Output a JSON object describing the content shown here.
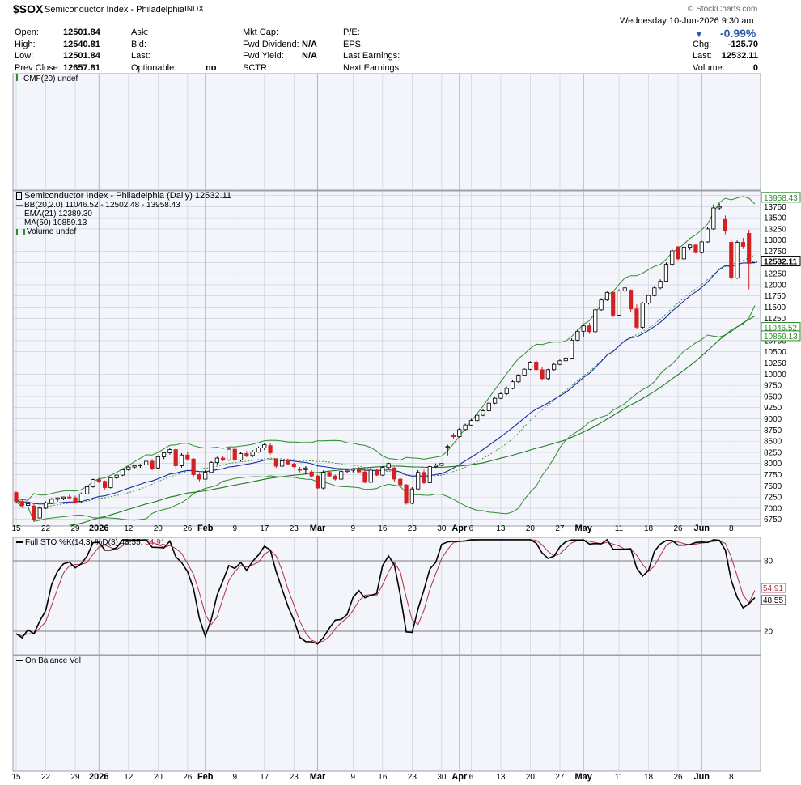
{
  "header": {
    "symbol": "$SOX",
    "name": "Semiconductor Index - Philadelphia",
    "exchange": "INDX",
    "brand": "© StockCharts.com",
    "date": "Wednesday  10-Jun-2026  9:30 am",
    "change_pct": "-0.99%",
    "quote_rows": [
      {
        "l1": "Open:",
        "v1": "12501.84",
        "l2": "Ask:",
        "v2": "",
        "l3": "Mkt Cap:",
        "v3": "",
        "l4": "P/E:",
        "v4": "",
        "l5": "",
        "v5": ""
      },
      {
        "l1": "High:",
        "v1": "12540.81",
        "l2": "Bid:",
        "v2": "",
        "l3": "Fwd Dividend:",
        "v3": "N/A",
        "l4": "EPS:",
        "v4": "",
        "l5": "Chg:",
        "v5": "-125.70"
      },
      {
        "l1": "Low:",
        "v1": "12501.84",
        "l2": "Last:",
        "v2": "",
        "l3": "Fwd Yield:",
        "v3": "N/A",
        "l4": "Last Earnings:",
        "v4": "",
        "l5": "Last:",
        "v5": "12532.11"
      },
      {
        "l1": "Prev Close:",
        "v1": "12657.81",
        "l2": "Optionable:",
        "v2": "no",
        "l3": "SCTR:",
        "v3": "",
        "l4": "Next Earnings:",
        "v4": "",
        "l5": "Volume:",
        "v5": "0"
      }
    ]
  },
  "panels": {
    "cmf_label": "CMF(20) undef",
    "price_legend": {
      "title": "Semiconductor Index - Philadelphia (Daily) 12532.11",
      "bb": "BB(20,2.0) 11046.52 - 12502.48 - 13958.43",
      "ema": "EMA(21) 12389.30",
      "ma": "MA(50) 10859.13",
      "volume": "Volume undef"
    },
    "sto_label": "Full STO %K(14,3) %D(3)",
    "sto_k_value": "48.55,",
    "sto_d_value": "54.91",
    "obv_label": "On Balance Vol"
  },
  "axis_labels": {
    "price_right": [
      "13750",
      "13500",
      "13250",
      "13000",
      "12750",
      "12250",
      "12000",
      "11750",
      "11500",
      "11250",
      "10750",
      "10500",
      "10250",
      "10000",
      "9750",
      "9500",
      "9250",
      "9000",
      "8750",
      "8500",
      "8250",
      "8000",
      "7750",
      "7500",
      "7250",
      "7000",
      "6750"
    ],
    "price_tags": [
      {
        "value": "13958.43",
        "color": "#2e8b2e"
      },
      {
        "value": "12532.11",
        "color": "#000000"
      },
      {
        "value": "11046.52",
        "color": "#2e8b2e"
      },
      {
        "value": "10859.13",
        "color": "#2e8b2e"
      }
    ],
    "sto_right": [
      "80",
      "20"
    ],
    "sto_tags": [
      {
        "value": "54.91",
        "color": "#b03040"
      },
      {
        "value": "48.55",
        "color": "#000000"
      }
    ],
    "x_ticks": [
      {
        "t": "15",
        "bold": false
      },
      {
        "t": "22",
        "bold": false
      },
      {
        "t": "29",
        "bold": false
      },
      {
        "t": "2026",
        "bold": true
      },
      {
        "t": "12",
        "bold": false
      },
      {
        "t": "20",
        "bold": false
      },
      {
        "t": "26",
        "bold": false
      },
      {
        "t": "Feb",
        "bold": true
      },
      {
        "t": "9",
        "bold": false
      },
      {
        "t": "17",
        "bold": false
      },
      {
        "t": "23",
        "bold": false
      },
      {
        "t": "Mar",
        "bold": true
      },
      {
        "t": "9",
        "bold": false
      },
      {
        "t": "16",
        "bold": false
      },
      {
        "t": "23",
        "bold": false
      },
      {
        "t": "30",
        "bold": false
      },
      {
        "t": "Apr",
        "bold": true
      },
      {
        "t": "6",
        "bold": false
      },
      {
        "t": "13",
        "bold": false
      },
      {
        "t": "20",
        "bold": false
      },
      {
        "t": "27",
        "bold": false
      },
      {
        "t": "May",
        "bold": true
      },
      {
        "t": "11",
        "bold": false
      },
      {
        "t": "18",
        "bold": false
      },
      {
        "t": "26",
        "bold": false
      },
      {
        "t": "Jun",
        "bold": true
      },
      {
        "t": "8",
        "bold": false
      }
    ]
  },
  "colors": {
    "bullish_candle": "#ffffff",
    "bearish_candle": "#d42020",
    "ema": "#1a2fa0",
    "ma50": "#1f7a1f",
    "bb": "#2e8b2e",
    "sto_k": "#000000",
    "sto_d": "#b03040",
    "grid": "#c8ccd8",
    "panel_bg": "#f3f5fb"
  },
  "chart_data": {
    "type": "candlestick",
    "title": "Semiconductor Index - Philadelphia (Daily)",
    "date_range": [
      "2025-12-15",
      "2026-06-10"
    ],
    "ylim": [
      6600,
      14100
    ],
    "ohlc": [
      [
        7350,
        7380,
        7100,
        7150
      ],
      [
        7150,
        7200,
        7020,
        7060
      ],
      [
        7060,
        7150,
        6950,
        7100
      ],
      [
        7050,
        7100,
        6700,
        6750
      ],
      [
        6780,
        7050,
        6760,
        7000
      ],
      [
        7000,
        7150,
        6980,
        7120
      ],
      [
        7120,
        7230,
        7090,
        7200
      ],
      [
        7200,
        7240,
        7150,
        7230
      ],
      [
        7220,
        7260,
        7180,
        7250
      ],
      [
        7250,
        7300,
        7200,
        7230
      ],
      [
        7230,
        7280,
        7100,
        7130
      ],
      [
        7150,
        7350,
        7120,
        7320
      ],
      [
        7320,
        7500,
        7300,
        7480
      ],
      [
        7480,
        7660,
        7460,
        7640
      ],
      [
        7640,
        7680,
        7560,
        7600
      ],
      [
        7600,
        7620,
        7420,
        7460
      ],
      [
        7460,
        7700,
        7440,
        7680
      ],
      [
        7680,
        7760,
        7650,
        7740
      ],
      [
        7740,
        7880,
        7720,
        7860
      ],
      [
        7860,
        7940,
        7840,
        7920
      ],
      [
        7920,
        7970,
        7880,
        7950
      ],
      [
        7950,
        7990,
        7900,
        7970
      ],
      [
        7970,
        8060,
        7960,
        8050
      ],
      [
        8050,
        8100,
        7850,
        7880
      ],
      [
        7900,
        8180,
        7880,
        8150
      ],
      [
        8150,
        8260,
        8100,
        8240
      ],
      [
        8240,
        8350,
        8200,
        8310
      ],
      [
        8310,
        8330,
        7900,
        7950
      ],
      [
        7950,
        8230,
        7910,
        8190
      ],
      [
        8190,
        8260,
        8060,
        8100
      ],
      [
        8100,
        8120,
        7700,
        7750
      ],
      [
        7750,
        7800,
        7600,
        7650
      ],
      [
        7650,
        7850,
        7640,
        7800
      ],
      [
        7800,
        8050,
        7780,
        8020
      ],
      [
        8020,
        8150,
        7980,
        8120
      ],
      [
        8120,
        8170,
        8050,
        8080
      ],
      [
        8080,
        8360,
        8060,
        8320
      ],
      [
        8320,
        8380,
        8040,
        8080
      ],
      [
        8080,
        8260,
        8040,
        8220
      ],
      [
        8220,
        8280,
        8140,
        8180
      ],
      [
        8180,
        8300,
        8140,
        8260
      ],
      [
        8260,
        8380,
        8240,
        8350
      ],
      [
        8350,
        8450,
        8300,
        8420
      ],
      [
        8400,
        8450,
        8200,
        8240
      ],
      [
        8100,
        8120,
        7900,
        7940
      ],
      [
        7940,
        8090,
        7920,
        8060
      ],
      [
        8060,
        8110,
        7960,
        7990
      ],
      [
        7990,
        8020,
        7900,
        7930
      ],
      [
        7880,
        7920,
        7800,
        7850
      ],
      [
        7860,
        7940,
        7760,
        7900
      ],
      [
        7810,
        7850,
        7680,
        7720
      ],
      [
        7720,
        7740,
        7430,
        7450
      ],
      [
        7450,
        7850,
        7420,
        7800
      ],
      [
        7800,
        7830,
        7700,
        7720
      ],
      [
        7720,
        7750,
        7620,
        7650
      ],
      [
        7650,
        7850,
        7630,
        7820
      ],
      [
        7820,
        7870,
        7780,
        7850
      ],
      [
        7850,
        7900,
        7800,
        7880
      ],
      [
        7880,
        7920,
        7800,
        7810
      ],
      [
        7810,
        7880,
        7560,
        7580
      ],
      [
        7580,
        7880,
        7560,
        7850
      ],
      [
        7850,
        7870,
        7720,
        7740
      ],
      [
        7740,
        7940,
        7720,
        7910
      ],
      [
        7910,
        8020,
        7880,
        8000
      ],
      [
        7900,
        7920,
        7600,
        7650
      ],
      [
        7650,
        7680,
        7500,
        7520
      ],
      [
        7520,
        7540,
        7080,
        7110
      ],
      [
        7110,
        7470,
        7090,
        7430
      ],
      [
        7430,
        7850,
        7420,
        7800
      ],
      [
        7800,
        7860,
        7540,
        7570
      ],
      [
        7570,
        7960,
        7550,
        7930
      ],
      [
        7930,
        8000,
        7900,
        7960
      ],
      [
        7960,
        8000,
        7940,
        8000
      ],
      [
        8380,
        8420,
        8180,
        8380
      ],
      [
        8630,
        8680,
        8550,
        8600
      ],
      [
        8600,
        8800,
        8580,
        8760
      ],
      [
        8760,
        8890,
        8720,
        8860
      ],
      [
        8860,
        9000,
        8840,
        8960
      ],
      [
        8960,
        9100,
        8920,
        9080
      ],
      [
        9080,
        9220,
        9060,
        9180
      ],
      [
        9180,
        9380,
        9150,
        9350
      ],
      [
        9350,
        9480,
        9330,
        9460
      ],
      [
        9460,
        9600,
        9440,
        9560
      ],
      [
        9560,
        9720,
        9530,
        9680
      ],
      [
        9680,
        9860,
        9660,
        9830
      ],
      [
        9830,
        10000,
        9800,
        9980
      ],
      [
        9980,
        10130,
        9960,
        10110
      ],
      [
        10110,
        10290,
        10090,
        10270
      ],
      [
        10270,
        10320,
        10060,
        10100
      ],
      [
        10100,
        10160,
        9860,
        9900
      ],
      [
        9900,
        10120,
        9880,
        10100
      ],
      [
        10100,
        10250,
        10080,
        10220
      ],
      [
        10220,
        10330,
        10200,
        10300
      ],
      [
        10300,
        10380,
        10280,
        10360
      ],
      [
        10360,
        10800,
        10330,
        10760
      ],
      [
        10760,
        11000,
        10740,
        10960
      ],
      [
        10960,
        11100,
        10840,
        11080
      ],
      [
        11080,
        11150,
        10900,
        10950
      ],
      [
        10950,
        11460,
        10930,
        11440
      ],
      [
        11440,
        11700,
        11420,
        11660
      ],
      [
        11660,
        11850,
        11640,
        11830
      ],
      [
        11830,
        11870,
        11280,
        11320
      ],
      [
        11320,
        11900,
        11300,
        11860
      ],
      [
        11860,
        11950,
        11840,
        11930
      ],
      [
        11880,
        11900,
        11400,
        11460
      ],
      [
        11460,
        11560,
        11000,
        11050
      ],
      [
        11050,
        11620,
        11020,
        11590
      ],
      [
        11590,
        11780,
        11560,
        11760
      ],
      [
        11760,
        11960,
        11740,
        11930
      ],
      [
        11930,
        12120,
        11900,
        12080
      ],
      [
        12080,
        12500,
        12060,
        12460
      ],
      [
        12460,
        12800,
        12420,
        12760
      ],
      [
        12850,
        12870,
        12550,
        12580
      ],
      [
        12580,
        12880,
        12550,
        12840
      ],
      [
        12840,
        12910,
        12780,
        12890
      ],
      [
        12890,
        12900,
        12700,
        12720
      ],
      [
        12720,
        12980,
        12700,
        12960
      ],
      [
        12960,
        13300,
        12940,
        13250
      ],
      [
        13250,
        13800,
        13230,
        13720
      ],
      [
        13720,
        13820,
        13680,
        13750
      ],
      [
        13480,
        13550,
        13130,
        13200
      ],
      [
        12950,
        12980,
        12100,
        12150
      ],
      [
        12150,
        12990,
        12130,
        12950
      ],
      [
        12950,
        13050,
        12800,
        12860
      ],
      [
        13150,
        13230,
        11900,
        12480
      ],
      [
        12501.84,
        12540.81,
        12501.84,
        12532.11
      ]
    ],
    "indicators": {
      "bb_upper_last": 13958.43,
      "bb_mid_last": 12502.48,
      "bb_lower_last": 11046.52,
      "ema21_last": 12389.3,
      "ma50_last": 10859.13
    },
    "stochastic": {
      "k_last": 48.55,
      "d_last": 54.91,
      "levels": [
        80,
        20
      ]
    }
  }
}
